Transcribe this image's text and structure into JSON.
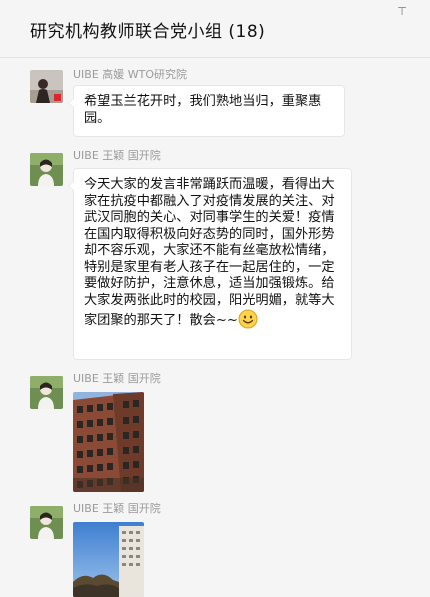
{
  "chat": {
    "title": "研究机构教师联合党小组 (18)",
    "pin_glyph": "⊤"
  },
  "messages": [
    {
      "sender": "UIBE 高媛 WTO研究院",
      "text": "希望玉兰花开时，我们熟地当归，重聚惠园。"
    },
    {
      "sender": "UIBE 王颖 国开院",
      "text": "今天大家的发言非常踊跃而温暖，看得出大家在抗疫中都融入了对疫情发展的关注、对武汉同胞的关心、对同事学生的关爱！疫情在国内取得积极向好态势的同时，国外形势却不容乐观，大家还不能有丝毫放松情绪，特别是家里有老人孩子在一起居住的，一定要做好防护，注意休息，适当加强锻炼。给大家发两张此时的校园，阳光明媚，就等大家团聚的那天了！散会~~",
      "emoji": "smile-icon"
    },
    {
      "sender": "UIBE 王颖 国开院",
      "image": "campus-building-photo"
    },
    {
      "sender": "UIBE 王颖 国开院",
      "image": "campus-sky-photo"
    }
  ]
}
